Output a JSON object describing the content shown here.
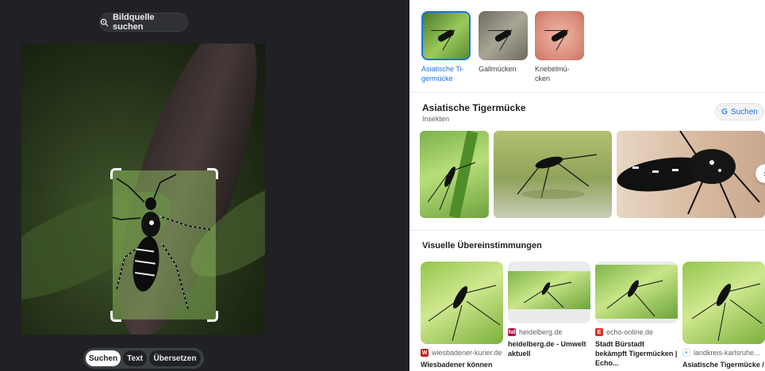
{
  "left": {
    "source_button": "Bildquelle suchen",
    "modes": [
      "Suchen",
      "Text",
      "Übersetzen"
    ],
    "active_mode": "Suchen"
  },
  "related": [
    {
      "label": "Asiatische Ti-germücke",
      "selected": true
    },
    {
      "label": "Gallmücken",
      "selected": false
    },
    {
      "label": "Kriebelmü-cken",
      "selected": false
    }
  ],
  "knowledge_panel": {
    "title": "Asiatische Tigermücke",
    "subtitle": "Insekten",
    "search_label": "Suchen"
  },
  "visual_matches": {
    "title": "Visuelle Übereinstimmungen",
    "items": [
      {
        "source": "wiesbadener-kurier.de",
        "title": "Wiesbadener können",
        "favicon_color": "#c5221f",
        "favicon": "W"
      },
      {
        "source": "heidelberg.de",
        "title": "heidelberg.de - Umwelt aktuell",
        "favicon_color": "#b3114a",
        "favicon": "hd"
      },
      {
        "source": "echo-online.de",
        "title": "Stadt Bürstadt bekämpft Tigermücken | Echo...",
        "favicon_color": "#d93025",
        "favicon": "E"
      },
      {
        "source": "landkreis-karlsruhe...",
        "title": "Asiatische Tigermücke /",
        "favicon_color": "#1a73e8",
        "favicon": "•"
      }
    ]
  },
  "colors": {
    "accent": "#1a73e8",
    "dark_bg": "#202124"
  }
}
